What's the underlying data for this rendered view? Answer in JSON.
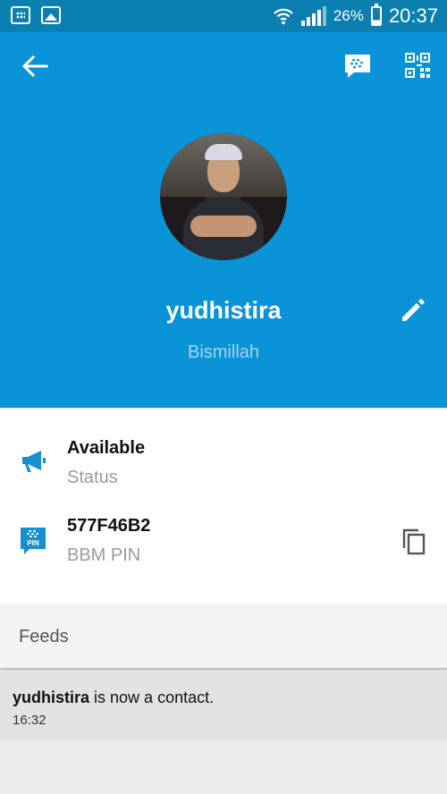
{
  "status_bar": {
    "battery_percent": "26%",
    "battery_level": 0.26,
    "time": "20:37",
    "left_icons": [
      "bbm-notification-icon",
      "gallery-notification-icon"
    ],
    "right_icons": [
      "wifi-icon",
      "signal-icon",
      "battery-icon"
    ]
  },
  "header": {
    "background_color": "#0a93d6",
    "icons": [
      "back-arrow-icon",
      "bbm-chat-icon",
      "qr-code-icon",
      "edit-pencil-icon"
    ],
    "profile_name": "yudhistira",
    "status_message": "Bismillah"
  },
  "info": {
    "availability": {
      "title": "Available",
      "label": "Status",
      "icon": "megaphone-icon"
    },
    "pin": {
      "title": "577F46B2",
      "label": "BBM PIN",
      "icon": "bbm-pin-icon",
      "pin_badge": "PIN",
      "action_icon": "copy-icon"
    }
  },
  "feeds": {
    "label": "Feeds",
    "items": [
      {
        "user": "yudhistira",
        "text": " is now a contact.",
        "time": "16:32"
      }
    ]
  },
  "colors": {
    "accent": "#0a93d6",
    "status_bar": "#0a7fb0",
    "icon_blue": "#1a8fd0"
  }
}
